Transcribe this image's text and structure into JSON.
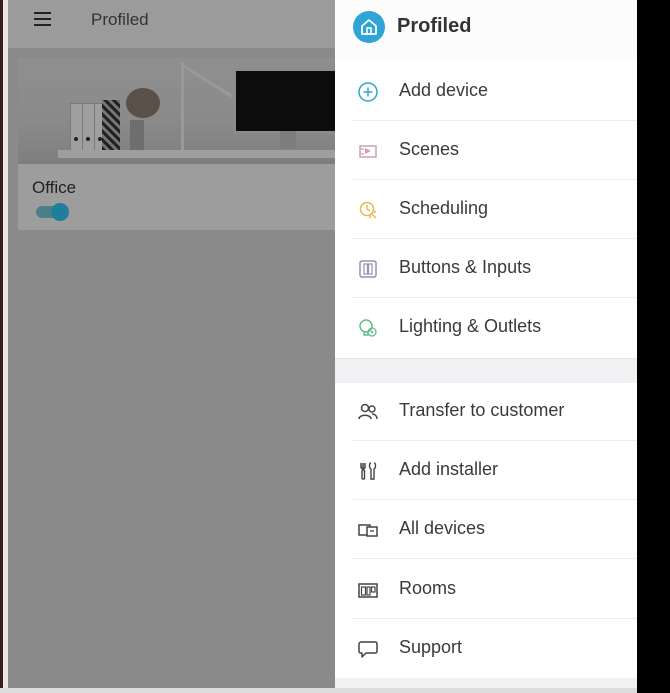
{
  "app": {
    "title": "Profiled"
  },
  "room_card": {
    "name": "Office",
    "toggle_on": true
  },
  "drawer": {
    "title": "Profiled",
    "items_primary": [
      {
        "label": "Add device",
        "icon": "add-circle-icon",
        "color": "#2ea5d6"
      },
      {
        "label": "Scenes",
        "icon": "scenes-icon",
        "color": "#d96a8a"
      },
      {
        "label": "Scheduling",
        "icon": "scheduling-icon",
        "color": "#e8b64a"
      },
      {
        "label": "Buttons & Inputs",
        "icon": "buttons-icon",
        "color": "#9a8fb0"
      },
      {
        "label": "Lighting & Outlets",
        "icon": "lighting-icon",
        "color": "#5fbf86"
      }
    ],
    "items_secondary": [
      {
        "label": "Transfer to customer",
        "icon": "users-icon"
      },
      {
        "label": "Add installer",
        "icon": "tools-icon"
      },
      {
        "label": "All devices",
        "icon": "devices-icon"
      },
      {
        "label": "Rooms",
        "icon": "rooms-icon"
      },
      {
        "label": "Support",
        "icon": "chat-bubble-icon"
      }
    ]
  }
}
